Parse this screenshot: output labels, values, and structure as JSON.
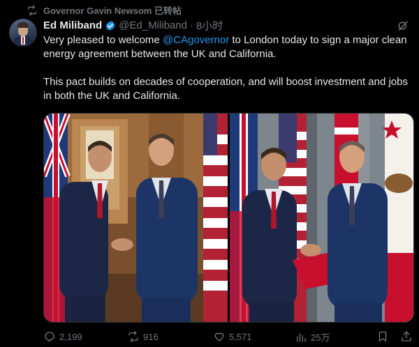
{
  "repost": {
    "text": "Governor Gavin Newsom 已转帖"
  },
  "tweet": {
    "display_name": "Ed Miliband",
    "handle": "@Ed_Miliband",
    "separator": "·",
    "time": "8小时",
    "line1_before": "Very pleased to welcome ",
    "mention": "@CAgovernor",
    "line1_after": " to London today to sign a major clean energy agreement between the UK and California.",
    "paragraph2": "This pact builds on decades of cooperation, and will boost investment and jobs in both the UK and California."
  },
  "actions": {
    "replies": "2,199",
    "reposts": "916",
    "likes": "5,571",
    "views": "25万"
  },
  "colors": {
    "background": "#000000",
    "text": "#e7e9ea",
    "muted": "#71767b",
    "accent": "#1d9bf0"
  },
  "icons": [
    "repost-icon",
    "verified-badge-icon",
    "grok-icon",
    "reply-icon",
    "like-icon",
    "views-icon",
    "bookmark-icon",
    "share-icon"
  ]
}
